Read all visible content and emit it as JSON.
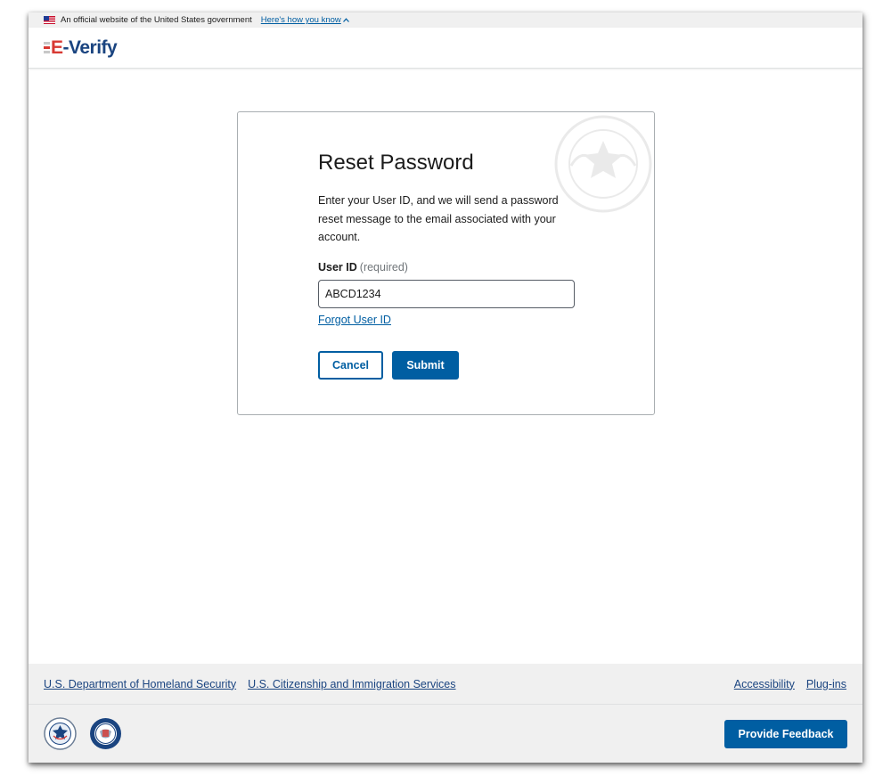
{
  "gov_banner": {
    "text": "An official website of the United States government",
    "link": "Here's how you know"
  },
  "header": {
    "logo_e": "E",
    "logo_rest": "-Verify"
  },
  "card": {
    "title": "Reset Password",
    "description": "Enter your User ID, and we will send a password reset message to the email associated with your account.",
    "field_label": "User ID",
    "field_required": "(required)",
    "user_id_value": "ABCD1234",
    "forgot_link": "Forgot User ID",
    "cancel_label": "Cancel",
    "submit_label": "Submit"
  },
  "footer": {
    "left_links": [
      "U.S. Department of Homeland Security",
      "U.S. Citizenship and Immigration Services"
    ],
    "right_links": [
      "Accessibility",
      "Plug-ins"
    ],
    "feedback_label": "Provide Feedback"
  },
  "colors": {
    "primary": "#005ea2",
    "brand_navy": "#1a4480",
    "brand_red": "#d83933",
    "footer_bg": "#f0f0f0"
  },
  "icons": [
    "us-flag-icon",
    "chevron-up-icon",
    "dhs-seal-icon",
    "uscis-seal-icon"
  ]
}
